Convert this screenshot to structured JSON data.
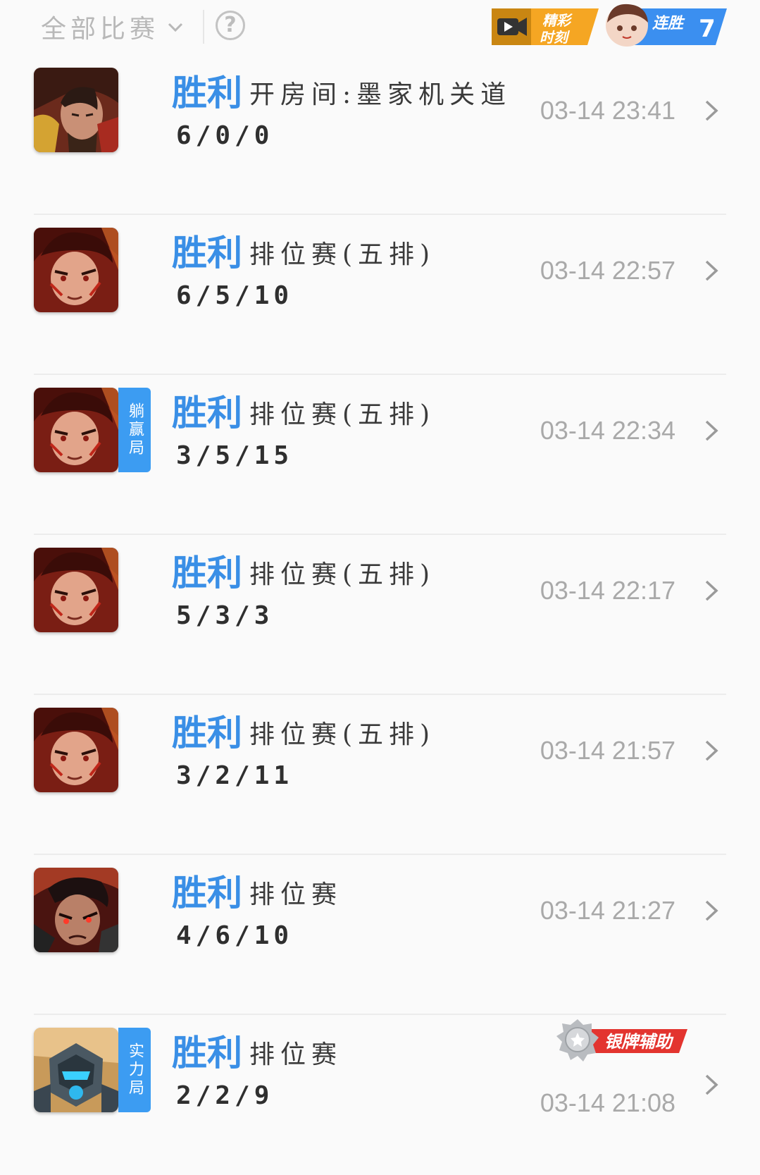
{
  "header": {
    "filter_label": "全部比赛",
    "help_symbol": "?",
    "highlight_text_1": "精彩",
    "highlight_text_2": "时刻",
    "streak_label": "连胜",
    "streak_count": "7"
  },
  "matches": [
    {
      "result": "胜利",
      "mode": "开房间:墨家机关道",
      "kda": "6/0/0",
      "time": "03-14 23:41",
      "hero_icon": "hero-portrait-warrior-gold",
      "tag": null,
      "medal": null
    },
    {
      "result": "胜利",
      "mode": "排位赛(五排)",
      "kda": "6/5/10",
      "time": "03-14 22:57",
      "hero_icon": "hero-portrait-red",
      "tag": null,
      "medal": null
    },
    {
      "result": "胜利",
      "mode": "排位赛(五排)",
      "kda": "3/5/15",
      "time": "03-14 22:34",
      "hero_icon": "hero-portrait-red",
      "tag": "躺赢局",
      "medal": null
    },
    {
      "result": "胜利",
      "mode": "排位赛(五排)",
      "kda": "5/3/3",
      "time": "03-14 22:17",
      "hero_icon": "hero-portrait-red",
      "tag": null,
      "medal": null
    },
    {
      "result": "胜利",
      "mode": "排位赛(五排)",
      "kda": "3/2/11",
      "time": "03-14 21:57",
      "hero_icon": "hero-portrait-red",
      "tag": null,
      "medal": null
    },
    {
      "result": "胜利",
      "mode": "排位赛",
      "kda": "4/6/10",
      "time": "03-14 21:27",
      "hero_icon": "hero-portrait-dark",
      "tag": null,
      "medal": null
    },
    {
      "result": "胜利",
      "mode": "排位赛",
      "kda": "2/2/9",
      "time": "03-14 21:08",
      "hero_icon": "hero-portrait-robot-blue",
      "tag": "实力局",
      "medal": "银牌辅助"
    }
  ],
  "colors": {
    "win_blue": "#3a8fe6",
    "tag_blue": "#3c9cf2",
    "medal_red": "#e3342f",
    "highlight_orange": "#f5a623",
    "streak_blue": "#3b8ff0"
  }
}
